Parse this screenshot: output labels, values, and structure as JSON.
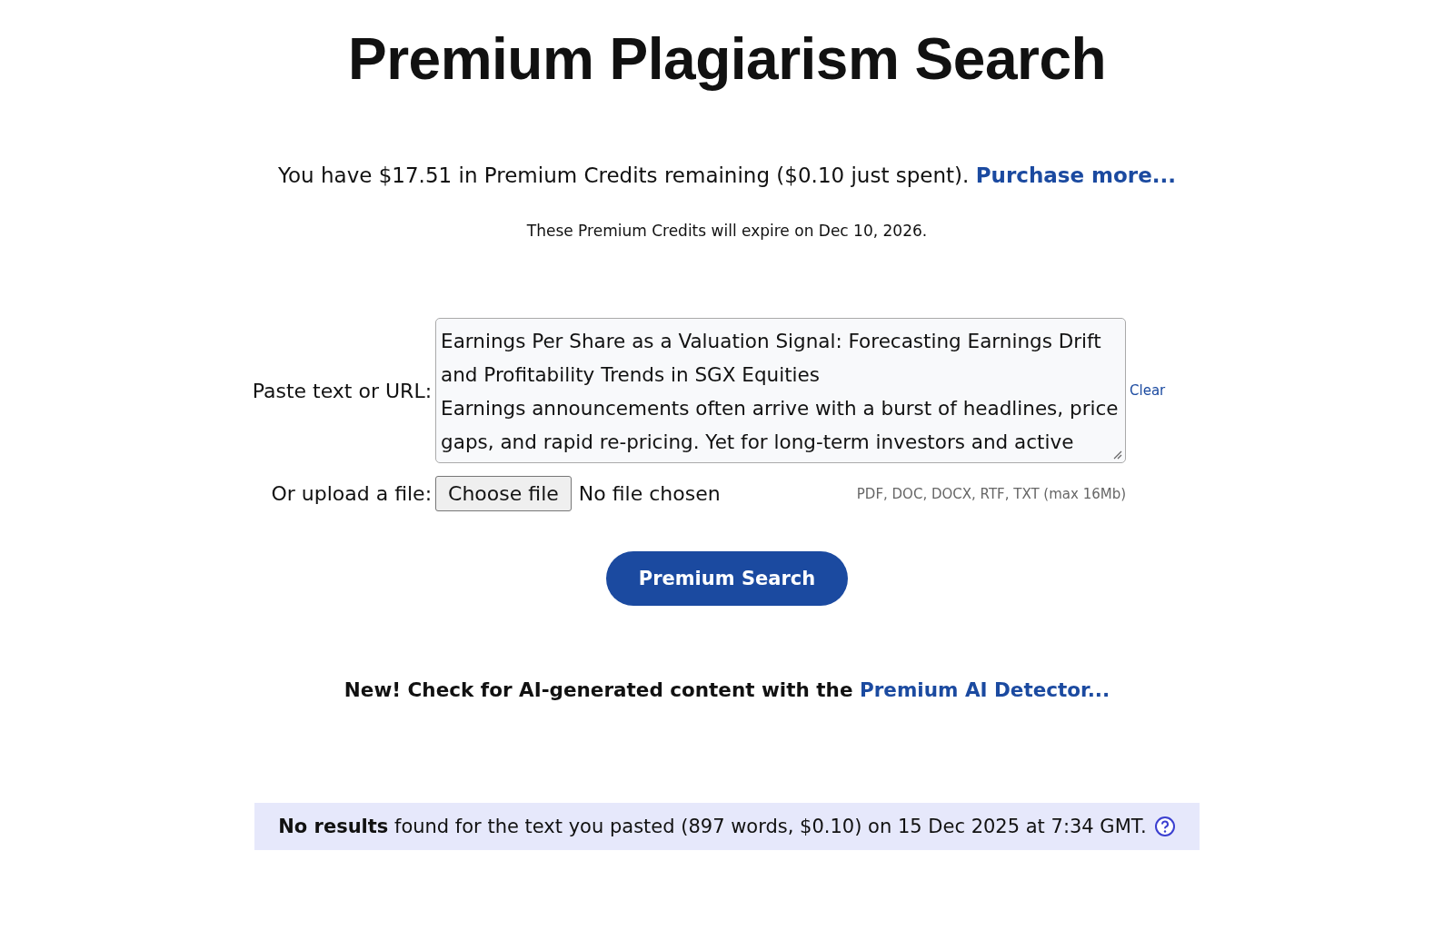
{
  "title": "Premium Plagiarism Search",
  "credits": {
    "text": "You have $17.51 in Premium Credits remaining ($0.10 just spent).",
    "link": "Purchase more..."
  },
  "expiry": "These Premium Credits will expire on Dec 10, 2026.",
  "paste": {
    "label": "Paste text or URL:",
    "lines": [
      "Earnings Per Share as a Valuation Signal: Forecasting Earnings Drift",
      "and Profitability Trends in SGX Equities",
      "Earnings announcements often arrive with a burst of headlines, price",
      "gaps, and rapid re-pricing. Yet for long-term investors and active"
    ],
    "clear": "Clear"
  },
  "upload": {
    "label": "Or upload a file:",
    "button": "Choose file",
    "status": "No file chosen",
    "hint": "PDF, DOC, DOCX, RTF, TXT (max 16Mb)"
  },
  "search_button": "Premium Search",
  "ai_notice": {
    "text": "New! Check for AI-generated content with the",
    "link": "Premium AI Detector..."
  },
  "result": "**No results** found for the text you pasted (897 words, $0.10) on 15 Dec 2025 at 7:34 GMT."
}
